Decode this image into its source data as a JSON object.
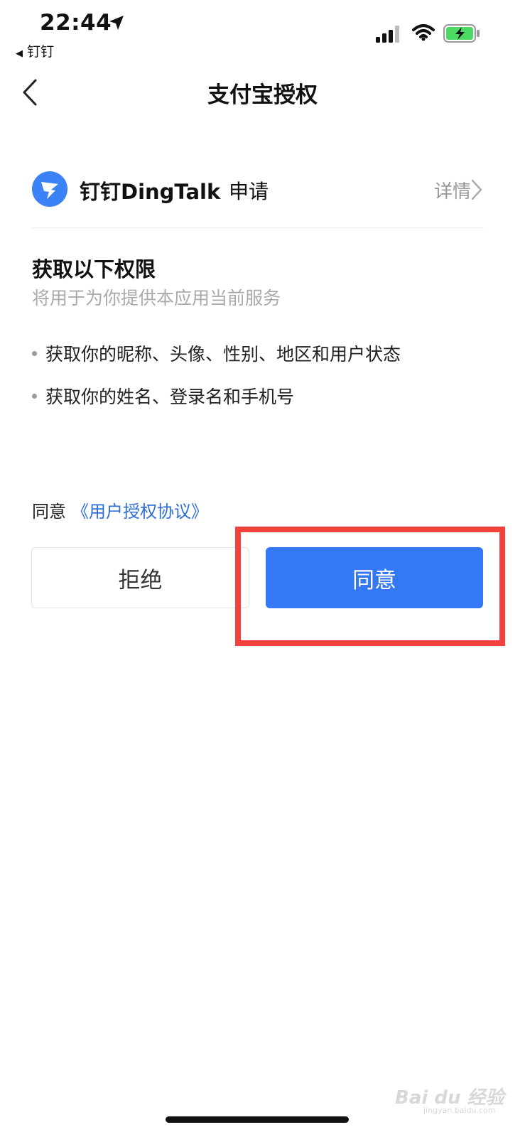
{
  "status_bar": {
    "time": "22:44",
    "back_app": "钉钉",
    "icons": [
      "location-arrow-icon",
      "cellular-signal-icon",
      "wifi-icon",
      "battery-charging-icon"
    ],
    "battery_color": "#4cd964"
  },
  "nav": {
    "title": "支付宝授权",
    "back_icon": "chevron-left-icon"
  },
  "app": {
    "name": "钉钉DingTalk",
    "apply_label": "申请",
    "details_label": "详情",
    "logo_color": "#3b82f6"
  },
  "permissions": {
    "title": "获取以下权限",
    "subtitle": "将用于为你提供本应用当前服务",
    "items": [
      "获取你的昵称、头像、性别、地区和用户状态",
      "获取你的姓名、登录名和手机号"
    ]
  },
  "agreement": {
    "prefix": "同意",
    "link": "《用户授权协议》"
  },
  "buttons": {
    "refuse": "拒绝",
    "agree": "同意"
  },
  "colors": {
    "accent": "#3478f6",
    "link": "#2f6fd6",
    "highlight": "#f2423b"
  },
  "watermark": {
    "text": "Bai du 经验",
    "sub": "jingyan.baidu.com"
  }
}
